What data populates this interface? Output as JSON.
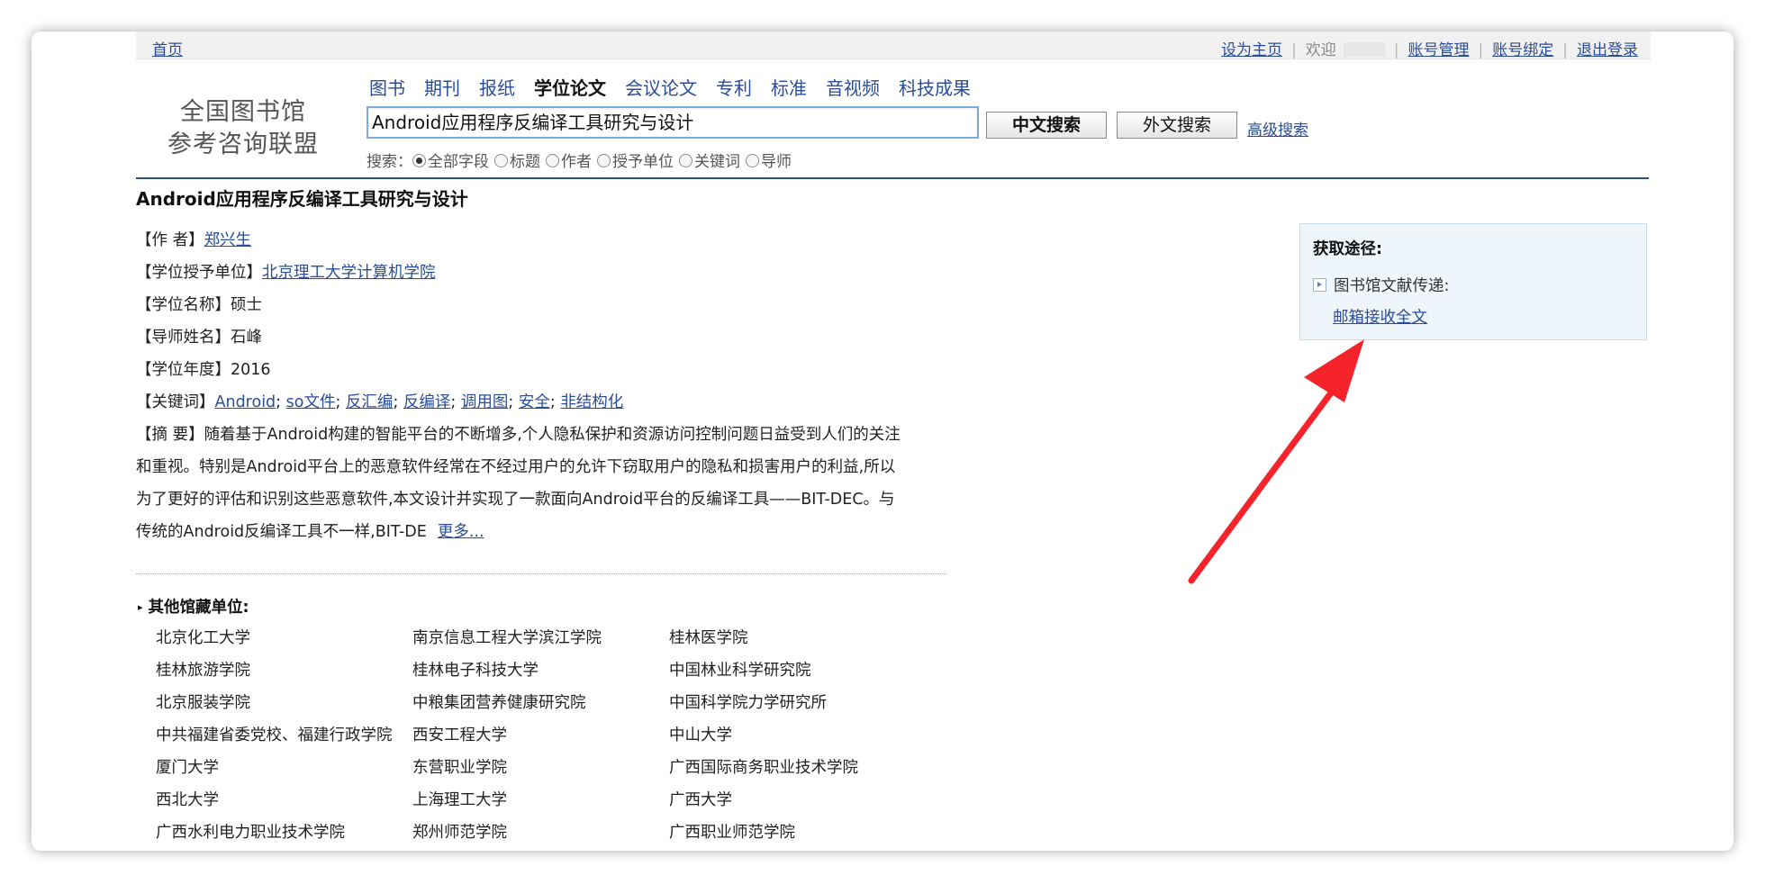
{
  "topbar": {
    "home": "首页",
    "set_home": "设为主页",
    "welcome": "欢迎",
    "account_manage": "账号管理",
    "account_bind": "账号绑定",
    "logout": "退出登录"
  },
  "logo": {
    "line1": "全国图书馆",
    "line2": "参考咨询联盟"
  },
  "categories": [
    "图书",
    "期刊",
    "报纸",
    "学位论文",
    "会议论文",
    "专利",
    "标准",
    "音视频",
    "科技成果"
  ],
  "active_category": "学位论文",
  "search": {
    "value": "Android应用程序反编译工具研究与设计",
    "btn_cn": "中文搜索",
    "btn_en": "外文搜索",
    "advanced": "高级搜索",
    "label": "搜索：",
    "options": [
      "全部字段",
      "标题",
      "作者",
      "授予单位",
      "关键词",
      "导师"
    ],
    "selected": "全部字段"
  },
  "record": {
    "title": "Android应用程序反编译工具研究与设计",
    "author_label": "【作 者】",
    "author": "郑兴生",
    "unit_label": "【学位授予单位】",
    "unit": "北京理工大学计算机学院",
    "degree_label": "【学位名称】",
    "degree": "硕士",
    "advisor_label": "【导师姓名】",
    "advisor": "石峰",
    "year_label": "【学位年度】",
    "year": "2016",
    "keywords_label": "【关键词】",
    "keywords": [
      "Android",
      "so文件",
      "反汇编",
      "反编译",
      "调用图",
      "安全",
      "非结构化"
    ],
    "abstract_label": "【摘 要】",
    "abstract_lines": [
      "随着基于Android构建的智能平台的不断增多,个人隐私保护和资源访问控制问题日益受到人们的关注",
      "和重视。特别是Android平台上的恶意软件经常在不经过用户的允许下窃取用户的隐私和损害用户的利益,所以",
      "为了更好的评估和识别这些恶意软件,本文设计并实现了一款面向Android平台的反编译工具——BIT-DEC。与",
      "传统的Android反编译工具不一样,BIT-DE"
    ],
    "more": "更多..."
  },
  "holdings": {
    "title": "其他馆藏单位:",
    "rows": [
      [
        "北京化工大学",
        "南京信息工程大学滨江学院",
        "桂林医学院"
      ],
      [
        "桂林旅游学院",
        "桂林电子科技大学",
        "中国林业科学研究院"
      ],
      [
        "北京服装学院",
        "中粮集团营养健康研究院",
        "中国科学院力学研究所"
      ],
      [
        "中共福建省委党校、福建行政学院",
        "西安工程大学",
        "中山大学"
      ],
      [
        "厦门大学",
        "东营职业学院",
        "广西国际商务职业技术学院"
      ],
      [
        "西北大学",
        "上海理工大学",
        "广西大学"
      ],
      [
        "广西水利电力职业技术学院",
        "郑州师范学院",
        "广西职业师范学院"
      ]
    ]
  },
  "access": {
    "title": "获取途径:",
    "item": "图书馆文献传递:",
    "link": "邮箱接收全文"
  },
  "annotation": {
    "arrow_color": "#f5232a"
  }
}
